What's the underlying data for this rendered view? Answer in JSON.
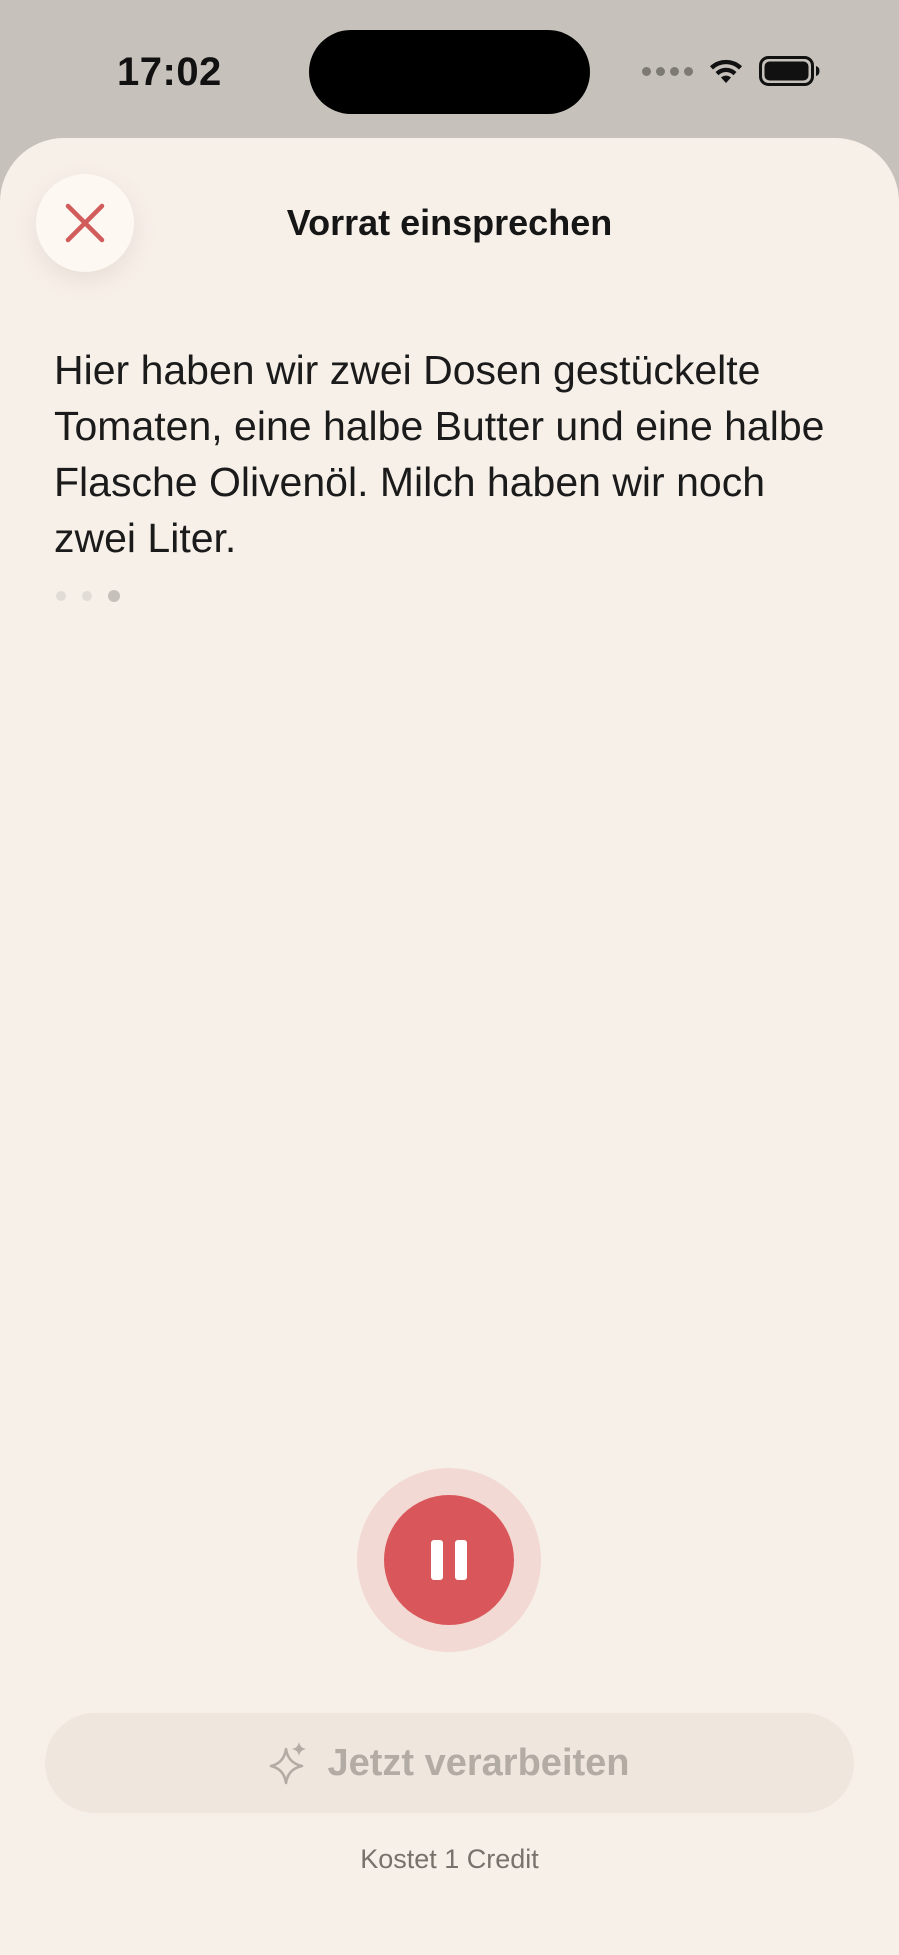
{
  "status_bar": {
    "time": "17:02",
    "icons": [
      "cellular-signal-icon",
      "wifi-icon",
      "battery-icon"
    ]
  },
  "header": {
    "title": "Vorrat einsprechen",
    "close_icon": "close-icon"
  },
  "transcript": {
    "text": "Hier haben wir zwei Dosen gestückelte Tomaten, eine halbe Butter und eine halbe Flasche Olivenöl. Milch haben wir noch zwei Liter."
  },
  "recording": {
    "state": "recording",
    "button_icon": "pause-icon"
  },
  "process": {
    "label": "Jetzt verarbeiten",
    "icon": "sparkles-icon",
    "cost_note": "Kostet 1 Credit",
    "enabled": false
  },
  "colors": {
    "background": "#f7f0e9",
    "accent": "#d9575a",
    "halo": "#f2d9d3",
    "disabled_button": "#efe7de",
    "disabled_text": "#b2aca5"
  }
}
